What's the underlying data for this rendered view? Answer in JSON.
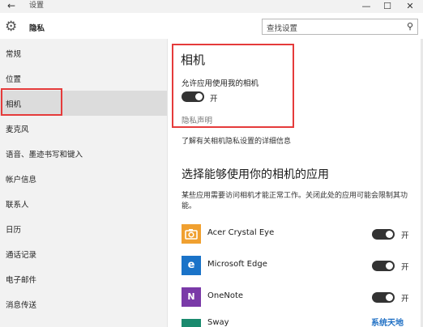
{
  "window": {
    "back_glyph": "←",
    "title": "设置",
    "min_glyph": "—",
    "max_glyph": "☐",
    "close_glyph": "✕"
  },
  "header": {
    "page_title": "隐私",
    "search_placeholder": "查找设置"
  },
  "sidebar": {
    "items": [
      {
        "label": "常规"
      },
      {
        "label": "位置"
      },
      {
        "label": "相机",
        "selected": true
      },
      {
        "label": "麦克风"
      },
      {
        "label": "语音、墨迹书写和键入"
      },
      {
        "label": "帐户信息"
      },
      {
        "label": "联系人"
      },
      {
        "label": "日历"
      },
      {
        "label": "通话记录"
      },
      {
        "label": "电子邮件"
      },
      {
        "label": "消息传送"
      }
    ]
  },
  "camera": {
    "title": "相机",
    "allow_label": "允许应用使用我的相机",
    "toggle_state": "开",
    "privacy_link": "隐私声明",
    "learn_more": "了解有关相机隐私设置的详细信息"
  },
  "apps_section": {
    "title": "选择能够使用你的相机的应用",
    "description": "某些应用需要访问相机才能正常工作。关闭此处的应用可能会限制其功能。",
    "apps": [
      {
        "name": "Acer Crystal Eye",
        "state": "开",
        "icon": "camera-icon",
        "color": "#f0a030"
      },
      {
        "name": "Microsoft Edge",
        "state": "开",
        "icon": "edge-icon",
        "color": "#1a73c8"
      },
      {
        "name": "OneNote",
        "state": "开",
        "icon": "onenote-icon",
        "color": "#7a3aa8"
      },
      {
        "name": "Sway",
        "icon": "sway-icon",
        "color": "#1a8a6e"
      }
    ]
  },
  "watermark": "系统天地",
  "colors": {
    "highlight_border": "#e53b3b",
    "toggle_on": "#333333",
    "sidebar_bg": "#f2f2f2"
  }
}
